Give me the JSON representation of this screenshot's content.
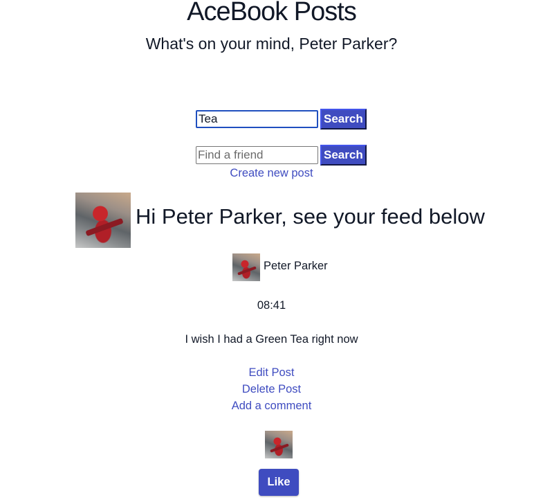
{
  "header": {
    "title": "AceBook Posts",
    "subtitle": "What's on your mind, Peter Parker?"
  },
  "post_search": {
    "value": "Tea",
    "placeholder": "",
    "button_label": "Search"
  },
  "friend_search": {
    "value": "",
    "placeholder": "Find a friend",
    "button_label": "Search"
  },
  "create_post_label": "Create new post",
  "feed": {
    "heading": "Hi Peter Parker, see your feed below"
  },
  "post": {
    "author": "Peter Parker",
    "time": "08:41",
    "body": "I wish I had a Green Tea right now",
    "actions": {
      "edit": "Edit Post",
      "delete": "Delete Post",
      "comment": "Add a comment"
    },
    "like_label": "Like"
  },
  "colors": {
    "accent": "#3f4cc0",
    "text": "#111827"
  }
}
